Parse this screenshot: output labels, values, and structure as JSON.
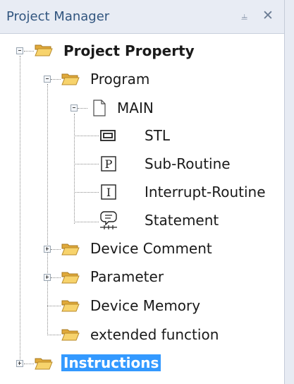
{
  "panel": {
    "title": "Project Manager",
    "pin_icon": "pin-icon",
    "close_icon": "close-icon"
  },
  "tree": {
    "root": {
      "label": "Project Property",
      "icon": "folder-open-icon",
      "expanded": true
    },
    "program": {
      "label": "Program",
      "icon": "folder-open-icon",
      "expanded": true
    },
    "main": {
      "label": "MAIN",
      "icon": "document-icon",
      "expanded": true
    },
    "stl": {
      "label": "STL",
      "icon": "stl-icon"
    },
    "subroutine": {
      "label": "Sub-Routine",
      "icon": "p-box-icon"
    },
    "interrupt": {
      "label": "Interrupt-Routine",
      "icon": "i-box-icon"
    },
    "statement": {
      "label": "Statement",
      "icon": "statement-icon"
    },
    "device_comment": {
      "label": "Device Comment",
      "icon": "folder-open-icon",
      "expanded": false
    },
    "parameter": {
      "label": "Parameter",
      "icon": "folder-open-icon",
      "expanded": false
    },
    "device_memory": {
      "label": "Device Memory",
      "icon": "folder-open-icon"
    },
    "extended": {
      "label": "extended function",
      "icon": "folder-open-icon"
    },
    "instructions": {
      "label": "Instructions",
      "icon": "folder-open-icon",
      "expanded": false,
      "selected": true
    }
  },
  "colors": {
    "header_bg": "#e8ecf4",
    "header_text": "#31557f",
    "selection": "#3399ff",
    "folder": "#f2c65a"
  }
}
